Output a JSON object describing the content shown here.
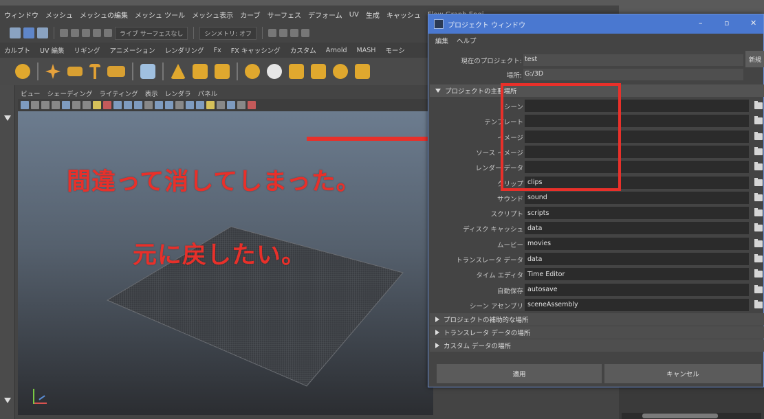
{
  "maya": {
    "menubar": [
      "ウィンドウ",
      "メッシュ",
      "メッシュの編集",
      "メッシュ ツール",
      "メッシュ表示",
      "カーブ",
      "サーフェス",
      "デフォーム",
      "UV",
      "生成",
      "キャッシュ",
      "Flow Graph Engi"
    ],
    "toolbar": {
      "live_surface": "ライブ サーフェスなし",
      "symmetry": "シンメトリ: オフ"
    },
    "shelf_tabs": [
      "カルブト",
      "UV 編集",
      "リギング",
      "アニメーション",
      "レンダリング",
      "Fx",
      "FX キャッシング",
      "カスタム",
      "Arnold",
      "MASH",
      "モーシ"
    ],
    "panel_menu": [
      "ビュー",
      "シェーディング",
      "ライティング",
      "表示",
      "レンダラ",
      "パネル"
    ]
  },
  "annotations": {
    "line1": "間違って消してしまった。",
    "line2": "元に戻したい。"
  },
  "dialog": {
    "title": "プロジェクト ウィンドウ",
    "menu": [
      "編集",
      "ヘルプ"
    ],
    "current_project_label": "現在のプロジェクト:",
    "current_project_value": "test",
    "location_label": "場所:",
    "location_value": "G:/3D",
    "new_button": "新規",
    "sections": {
      "primary": "プロジェクトの主要場所",
      "secondary": "プロジェクトの補助的な場所",
      "translator": "トランスレータ データの場所",
      "custom": "カスタム データの場所"
    },
    "locations": [
      {
        "label": "シーン",
        "value": ""
      },
      {
        "label": "テンプレート",
        "value": ""
      },
      {
        "label": "イメージ",
        "value": ""
      },
      {
        "label": "ソース イメージ",
        "value": ""
      },
      {
        "label": "レンダー データ",
        "value": ""
      },
      {
        "label": "クリップ",
        "value": "clips"
      },
      {
        "label": "サウンド",
        "value": "sound"
      },
      {
        "label": "スクリプト",
        "value": "scripts"
      },
      {
        "label": "ディスク キャッシュ",
        "value": "data"
      },
      {
        "label": "ムービー",
        "value": "movies"
      },
      {
        "label": "トランスレータ データ",
        "value": "data"
      },
      {
        "label": "タイム エディタ",
        "value": "Time Editor"
      },
      {
        "label": "自動保存",
        "value": "autosave"
      },
      {
        "label": "シーン アセンブリ",
        "value": "sceneAssembly"
      }
    ],
    "apply_button": "適用",
    "cancel_button": "キャンセル"
  },
  "colors": {
    "annotation_red": "#e8302a",
    "dialog_title_blue": "#4a78d0"
  }
}
